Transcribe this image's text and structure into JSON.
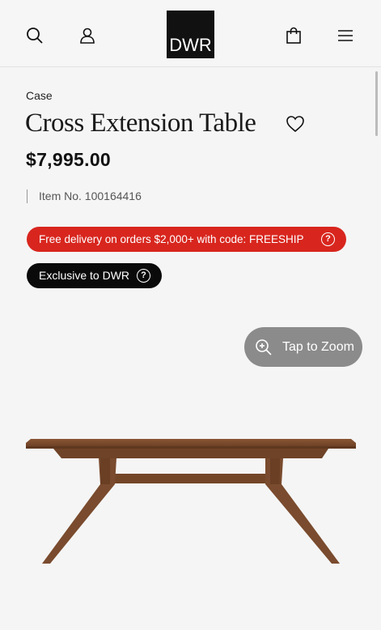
{
  "header": {
    "logo_text": "DWR",
    "icons": [
      "search-icon",
      "user-icon",
      "shopping-bag-icon",
      "menu-icon"
    ]
  },
  "product": {
    "brand": "Case",
    "title": "Cross Extension Table",
    "price": "$7,995.00",
    "item_label": "Item No. 100164416"
  },
  "promo": {
    "text": "Free delivery on orders $2,000+ with code: FREESHIP",
    "help": "?",
    "color": "#d8261e"
  },
  "exclusive": {
    "text": "Exclusive to DWR",
    "help": "?"
  },
  "zoom": {
    "label": "Tap to Zoom"
  },
  "colors": {
    "background": "#f5f5f5",
    "promo": "#d8261e",
    "badge": "#0a0a0a",
    "zoom_button": "#8b8b8b",
    "wood": "#7a4b2e"
  }
}
